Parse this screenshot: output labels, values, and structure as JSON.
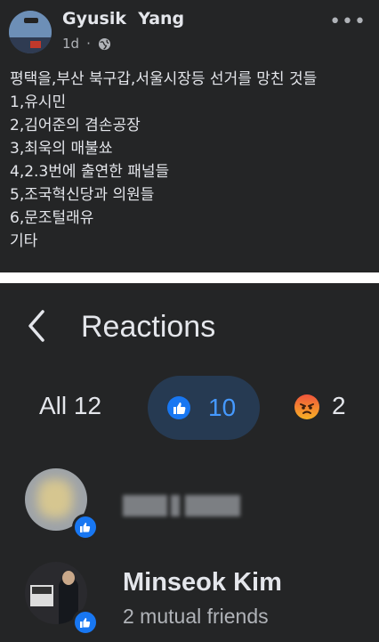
{
  "post": {
    "author": "Gyusik  Yang",
    "time": "1d",
    "privacy_icon": "globe-icon",
    "more_icon": "more-horizontal-icon",
    "lines": [
      "평택을,부산 북구갑,서울시장등 선거를 망친 것들",
      "1,유시민",
      "2,김어준의 겸손공장",
      "3,최욱의 매불쑈",
      "4,2.3번에 출연한 패널들",
      "5,조국혁신당과 의원들",
      "6,문조털래유",
      "기타"
    ]
  },
  "reactions": {
    "back_icon": "chevron-left-icon",
    "title": "Reactions",
    "tabs": {
      "all": "All 12",
      "like_count": "10",
      "angry_count": "2"
    },
    "colors": {
      "like": "#1877f2",
      "like_text": "#4599ff",
      "angry": "#f0553c"
    },
    "people": [
      {
        "name": "",
        "reaction": "like"
      },
      {
        "name": "Minseok Kim",
        "subtitle": "2 mutual friends",
        "reaction": "like"
      }
    ]
  }
}
